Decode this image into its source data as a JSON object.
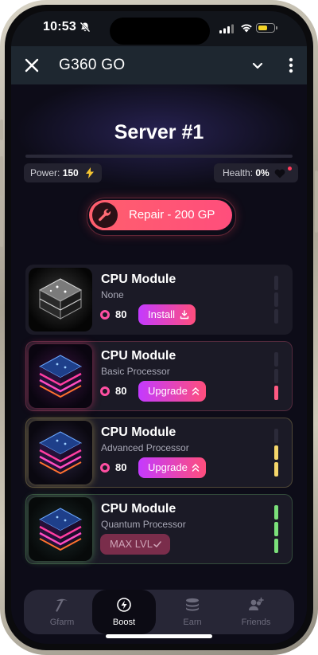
{
  "status_bar": {
    "time": "10:53"
  },
  "app_bar": {
    "title": "G360 GO"
  },
  "server": {
    "title": "Server #1",
    "power_label": "Power:",
    "power_value": "150",
    "health_label": "Health:",
    "health_value": "0%"
  },
  "repair": {
    "label": "Repair - 200 GP"
  },
  "modules": [
    {
      "title": "CPU Module",
      "subtitle": "None",
      "price": "80",
      "action": "Install",
      "level_filled": 0,
      "level_total": 3
    },
    {
      "title": "CPU Module",
      "subtitle": "Basic Processor",
      "price": "80",
      "action": "Upgrade",
      "level_filled": 1,
      "level_total": 3,
      "accent": "#ff5a82"
    },
    {
      "title": "CPU Module",
      "subtitle": "Advanced Processor",
      "price": "80",
      "action": "Upgrade",
      "level_filled": 2,
      "level_total": 3,
      "accent": "#f5d66a"
    },
    {
      "title": "CPU Module",
      "subtitle": "Quantum Processor",
      "action": "MAX LVL",
      "level_filled": 3,
      "level_total": 3,
      "accent": "#7be07a"
    }
  ],
  "nav": {
    "items": [
      {
        "label": "Gfarm",
        "icon": "pickaxe-icon"
      },
      {
        "label": "Boost",
        "icon": "boost-icon",
        "active": true
      },
      {
        "label": "Earn",
        "icon": "coins-icon"
      },
      {
        "label": "Friends",
        "icon": "friends-icon"
      }
    ]
  },
  "colors": {
    "accent_pink": "#ff4e7c",
    "accent_purple": "#c43aff",
    "background": "#0d0c18"
  }
}
